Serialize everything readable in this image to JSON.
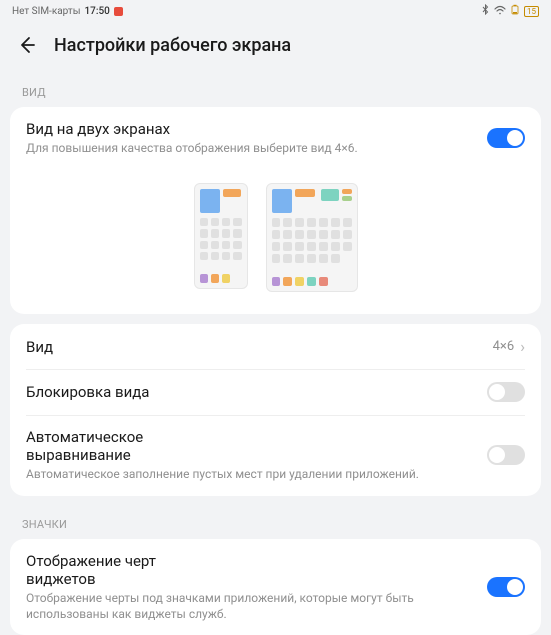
{
  "statusbar": {
    "carrier": "Нет SIM-карты",
    "time": "17:50",
    "battery": "15"
  },
  "header": {
    "title": "Настройки рабочего экрана"
  },
  "sections": {
    "view_label": "ВИД",
    "icons_label": "ЗНАЧКИ"
  },
  "dual_screen": {
    "title": "Вид на двух экранах",
    "subtitle": "Для повышения качества отображения выберите вид 4×6.",
    "enabled": true
  },
  "rows": {
    "view": {
      "title": "Вид",
      "value": "4×6"
    },
    "lock_view": {
      "title": "Блокировка вида",
      "enabled": false
    },
    "auto_align": {
      "title": "Автоматическое выравнивание",
      "subtitle": "Автоматическое заполнение пустых мест при удалении приложений.",
      "enabled": false
    },
    "widget_dashes": {
      "title": "Отображение черт виджетов",
      "subtitle": "Отображение черты под значками приложений, которые могут быть использованы как виджеты служб.",
      "enabled": true
    }
  }
}
